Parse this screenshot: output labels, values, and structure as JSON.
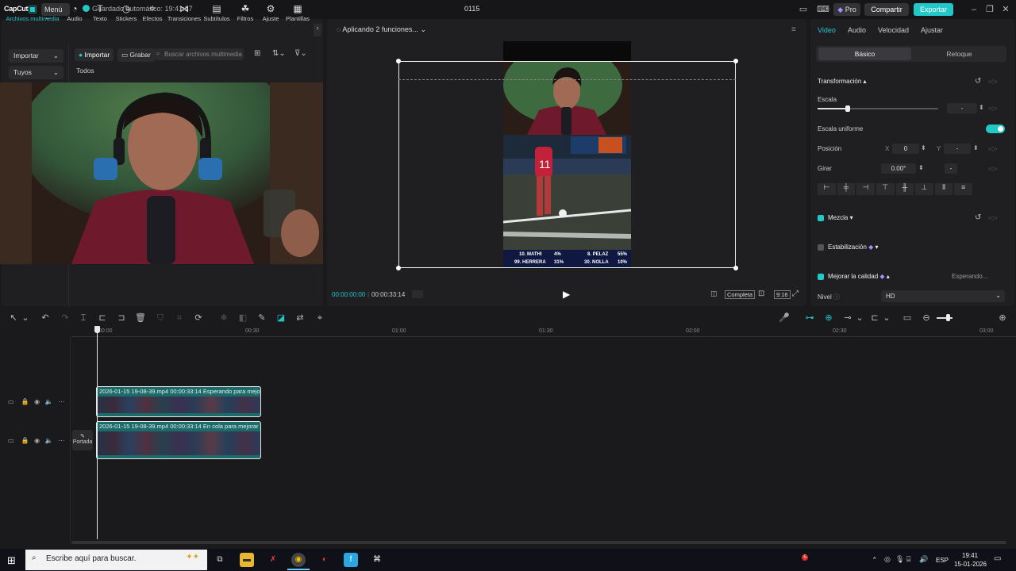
{
  "titlebar": {
    "logo": "CapCut",
    "menu": "Menú",
    "autosave": "Guardado automático: 19:41:17",
    "project": "0115",
    "pro": "Pro",
    "share": "Compartir",
    "export": "Exportar"
  },
  "media": {
    "categories": [
      "Archivos multimedia",
      "Audio",
      "Texto",
      "Stickers",
      "Efectos",
      "Transiciones",
      "Subtítulos",
      "Filtros",
      "Ajuste",
      "Plantillas"
    ],
    "import_select": "Importar",
    "source_select": "Tuyos",
    "import_btn": "Importar",
    "record_btn": "Grabar",
    "search_placeholder": "Buscar archivos multimedia",
    "filter_all": "Todos"
  },
  "preview": {
    "status": "Aplicando 2 funciones...",
    "time_current": "00:00:00:00",
    "time_total": "00:00:33:14",
    "fit": "Completa",
    "ratio": "9:16",
    "scoreboard": {
      "r1l": "10. MATHI",
      "r1lp": "4%",
      "r1r": "8. PELAZ",
      "r1rp": "55%",
      "r2l": "99. HERRERA",
      "r2lp": "31%",
      "r2r": "30. NOLLA",
      "r2rp": "10%"
    },
    "jersey": "11"
  },
  "props": {
    "tabs": [
      "Video",
      "Audio",
      "Velocidad",
      "Ajustar"
    ],
    "subtabs": [
      "Básico",
      "Retoque"
    ],
    "transform": "Transformación",
    "scale_label": "Escala",
    "scale_value": "-",
    "uniform": "Escala uniforme",
    "position": "Posición",
    "pos_x_label": "X",
    "pos_x": "0",
    "pos_y_label": "Y",
    "pos_y": "-",
    "rotate": "Girar",
    "rotate_value": "0.00°",
    "rotate_flip": "-",
    "blend": "Mezcla",
    "stabilize": "Estabilización",
    "enhance": "Mejorar la calidad",
    "enhance_status": "Esperando...",
    "level": "Nivel",
    "level_value": "HD",
    "scale_fraction": 0.25
  },
  "timeline": {
    "ticks": [
      "00:00",
      "00:30",
      "01:00",
      "01:30",
      "02:00",
      "02:30",
      "03:00"
    ],
    "clip1": "2026-01-15 19-08-39.mp4   00:00:33:14   Esperando para mejorar la",
    "clip2": "2026-01-15 19-08-39.mp4   00:00:33:14   En cola para mejorar la c",
    "cover": "Portada"
  },
  "taskbar": {
    "search": "Escribe aquí para buscar.",
    "lang": "ESP",
    "time": "19:41",
    "date": "15-01-2026",
    "badge": "5"
  }
}
